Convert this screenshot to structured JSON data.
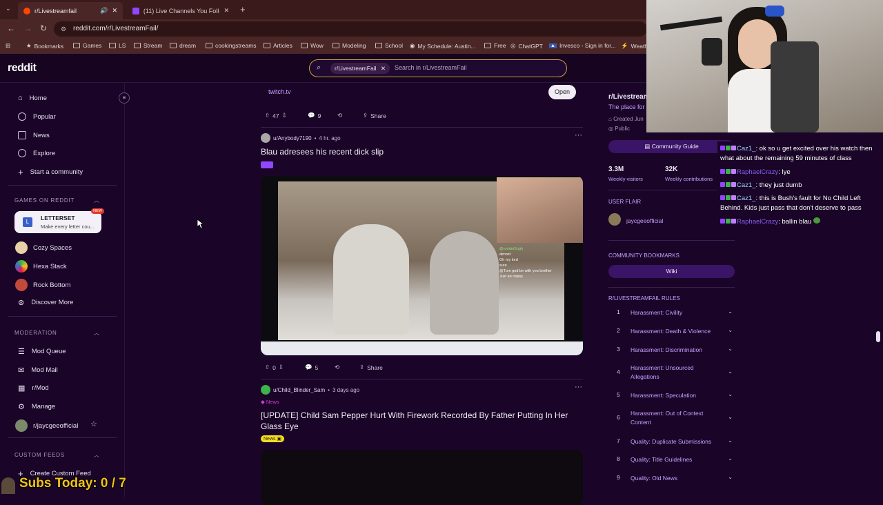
{
  "browser": {
    "tabs": [
      {
        "label": "r/Livestreamfail"
      },
      {
        "label": "(11) Live Channels You Follow -"
      }
    ],
    "url": "reddit.com/r/LivestreamFail/",
    "bookmarks": [
      "Bookmarks",
      "Games",
      "LS",
      "Stream",
      "dream",
      "cookingstreams",
      "Articles",
      "Wow",
      "Modeling",
      "School",
      "My Schedule: Austin...",
      "Free",
      "ChatGPT",
      "Invesco - Sign in for...",
      "Weath"
    ]
  },
  "header": {
    "logo": "reddit",
    "search_chip": "r/LivestreamFail",
    "search_placeholder": "Search in r/LivestreamFail"
  },
  "sidebar": {
    "nav": [
      {
        "label": "Home",
        "icon": "home-icon"
      },
      {
        "label": "Popular",
        "icon": "popular-icon"
      },
      {
        "label": "News",
        "icon": "news-icon"
      },
      {
        "label": "Explore",
        "icon": "explore-icon"
      },
      {
        "label": "Start a community",
        "icon": "plus-icon"
      }
    ],
    "games_header": "GAMES ON REDDIT",
    "featured_game": {
      "title": "LETTERSET",
      "subtitle": "Make every letter cou...",
      "badge": "NEW",
      "icon_letter": "L"
    },
    "games": [
      "Cozy Spaces",
      "Hexa Stack",
      "Rock Bottom",
      "Discover More"
    ],
    "moderation_header": "MODERATION",
    "moderation": [
      "Mod Queue",
      "Mod Mail",
      "r/Mod",
      "Manage",
      "r/jaycgeeofficial"
    ],
    "custom_feeds_header": "CUSTOM FEEDS",
    "create_feed": "Create Custom Feed"
  },
  "feed": {
    "link_domain": "twitch.tv",
    "open_button": "Open",
    "post0_actions": {
      "votes": "47",
      "comments": "9",
      "share": "Share"
    },
    "post1": {
      "author": "u/Anybody7190",
      "time": "4 hr. ago",
      "title": "Blau adresees his recent dick slip",
      "votes": "0",
      "comments": "5",
      "share": "Share",
      "overlay_lines": [
        "@rumboSugh",
        "almost",
        "Oh my lord",
        "sure",
        "@Turn god be with you brother",
        "Just an oopsy"
      ]
    },
    "post2": {
      "author": "u/Child_Blinder_Sam",
      "time": "3 days ago",
      "flair_top": "News",
      "title": "[UPDATE] Child Sam Pepper Hurt With Firework Recorded By Father Putting In Her Glass Eye",
      "flair": "News"
    }
  },
  "rpanel": {
    "sub_name": "r/Livestream",
    "tagline": "The place for",
    "created": "Created Jun",
    "visibility": "Public",
    "guide_button": "Community Guide",
    "stats": [
      {
        "value": "3.3M",
        "label": "Weekly visitors"
      },
      {
        "value": "32K",
        "label": "Weekly contributions"
      }
    ],
    "user_flair_header": "USER FLAIR",
    "user_flair_name": "jaycgeeofficial",
    "bookmarks_header": "COMMUNITY BOOKMARKS",
    "wiki": "Wiki",
    "rules_header": "R/LIVESTREAMFAIL RULES",
    "rules": [
      {
        "num": "1",
        "text": "Harassment: Civility"
      },
      {
        "num": "2",
        "text": "Harassment: Death & Violence"
      },
      {
        "num": "3",
        "text": "Harassment: Discrimination"
      },
      {
        "num": "4",
        "text": "Harassment: Unsourced Allegations"
      },
      {
        "num": "5",
        "text": "Harassment: Speculation"
      },
      {
        "num": "6",
        "text": "Harassment: Out of Context Content"
      },
      {
        "num": "7",
        "text": "Quality: Duplicate Submissions"
      },
      {
        "num": "8",
        "text": "Quality: Title Guidelines"
      },
      {
        "num": "9",
        "text": "Quality: Old News"
      }
    ]
  },
  "chat": {
    "lines": [
      {
        "user": "Caz1_",
        "color": "#9ad0ff",
        "text": ": ok so u get excited over his watch then what about the remaining 59 minutes of class"
      },
      {
        "user": "RaphaelCrazy",
        "color": "#8a5cf5",
        "text": ": lye"
      },
      {
        "user": "Caz1_",
        "color": "#9ad0ff",
        "text": ": they just dumb"
      },
      {
        "user": "Caz1_",
        "color": "#9ad0ff",
        "text": ": this is Bush's fault for No Child Left Behind. Kids just pass that don't deserve to pass"
      },
      {
        "user": "RaphaelCrazy",
        "color": "#8a5cf5",
        "text": ": ballin blau"
      }
    ]
  },
  "overlay": {
    "subs_text": "Subs Today: 0 / 7"
  },
  "colors": {
    "bg": "#1a0528",
    "accent": "#9b3dd6",
    "link": "#c9a0ff",
    "subs_yellow": "#f5c21b"
  }
}
